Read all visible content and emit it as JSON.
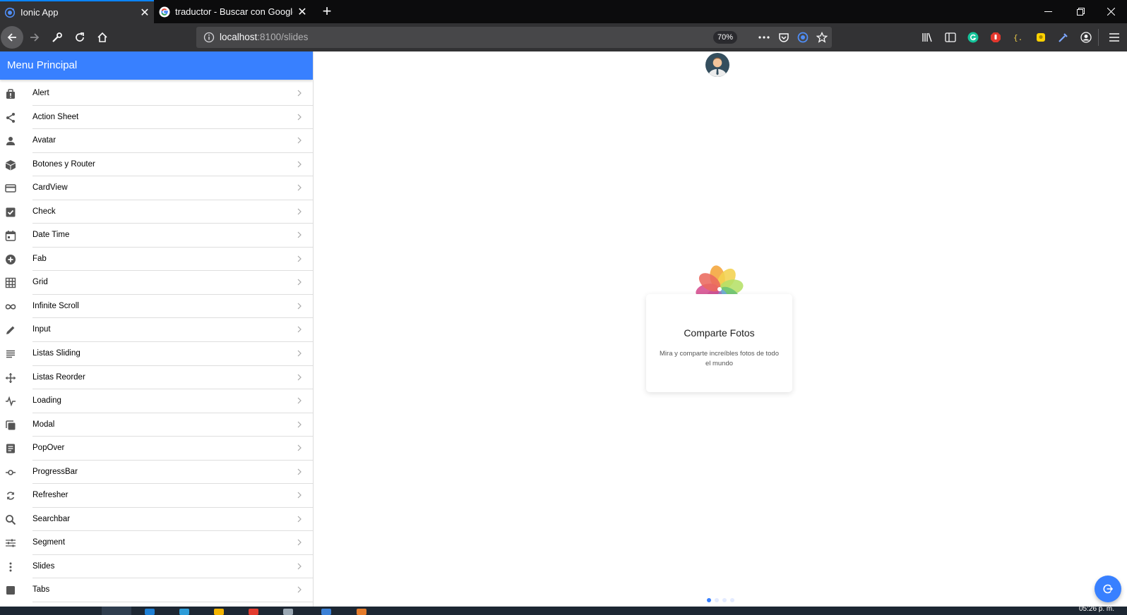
{
  "browser": {
    "tabs": [
      {
        "title": "Ionic App",
        "icon": "ionic-icon",
        "active": true
      },
      {
        "title": "traductor - Buscar con Google",
        "icon": "google-icon",
        "active": false
      }
    ],
    "url_host": "localhost",
    "url_path": ":8100/slides",
    "zoom": "70%"
  },
  "menu": {
    "title": "Menu Principal",
    "items": [
      {
        "label": "Alert",
        "icon": "alert-icon"
      },
      {
        "label": "Action Sheet",
        "icon": "share-icon"
      },
      {
        "label": "Avatar",
        "icon": "person-icon"
      },
      {
        "label": "Botones y Router",
        "icon": "cube-icon"
      },
      {
        "label": "CardView",
        "icon": "card-icon"
      },
      {
        "label": "Check",
        "icon": "checkbox-icon"
      },
      {
        "label": "Date Time",
        "icon": "calendar-icon"
      },
      {
        "label": "Fab",
        "icon": "add-circle-icon"
      },
      {
        "label": "Grid",
        "icon": "grid-icon"
      },
      {
        "label": "Infinite Scroll",
        "icon": "infinite-icon"
      },
      {
        "label": "Input",
        "icon": "pencil-icon"
      },
      {
        "label": "Listas Sliding",
        "icon": "list-icon"
      },
      {
        "label": "Listas Reorder",
        "icon": "move-icon"
      },
      {
        "label": "Loading",
        "icon": "pulse-icon"
      },
      {
        "label": "Modal",
        "icon": "copy-icon"
      },
      {
        "label": "PopOver",
        "icon": "document-icon"
      },
      {
        "label": "ProgressBar",
        "icon": "git-commit-icon"
      },
      {
        "label": "Refresher",
        "icon": "refresh-icon"
      },
      {
        "label": "Searchbar",
        "icon": "search-icon"
      },
      {
        "label": "Segment",
        "icon": "options-icon"
      },
      {
        "label": "Slides",
        "icon": "more-vertical-icon"
      },
      {
        "label": "Tabs",
        "icon": "square-icon"
      }
    ]
  },
  "slide": {
    "title": "Comparte Fotos",
    "description": "Mira y comparte increíbles fotos de todo el mundo",
    "image": "photos-flower-icon",
    "pager_count": 4,
    "pager_active": 1
  },
  "taskbar": {
    "clock": "05:26 p. m."
  },
  "colors": {
    "primary": "#3880ff",
    "browser_dark": "#0c0c0d",
    "toolbar": "#323234"
  }
}
